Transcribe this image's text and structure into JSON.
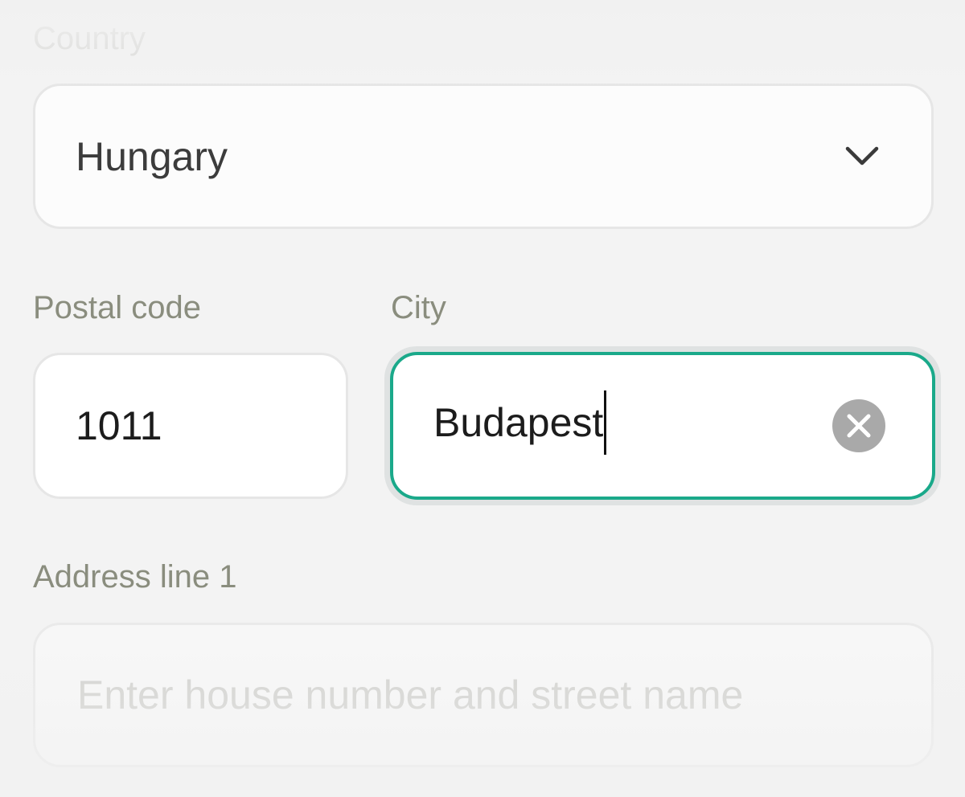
{
  "country": {
    "label": "Country",
    "selected": "Hungary",
    "chevron_icon": "chevron-down-icon"
  },
  "postal_code": {
    "label": "Postal code",
    "value": "1011"
  },
  "city": {
    "label": "City",
    "value": "Budapest",
    "clear_icon": "clear-circle-x-icon",
    "focus_color": "#1aa98a"
  },
  "address_line_1": {
    "label": "Address line 1",
    "placeholder": "Enter house number and street name"
  },
  "colors": {
    "label_text": "#8a8d7e",
    "focus_border": "#1aa98a",
    "clear_button": "#a9a9a9"
  }
}
